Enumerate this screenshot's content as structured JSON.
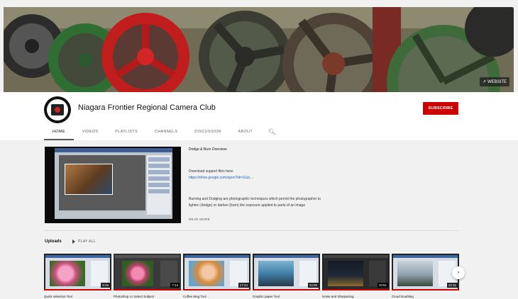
{
  "banner": {
    "links_label": "WEBSITE"
  },
  "channel": {
    "name": "Niagara Frontier Regional Camera Club",
    "subscribe_label": "SUBSCRIBE"
  },
  "tabs": [
    {
      "label": "HOME",
      "active": true
    },
    {
      "label": "VIDEOS"
    },
    {
      "label": "PLAYLISTS"
    },
    {
      "label": "CHANNELS"
    },
    {
      "label": "DISCUSSION"
    },
    {
      "label": "ABOUT"
    }
  ],
  "featured": {
    "title": "Dodge & Burn Overview",
    "desc_line1": "Download support files here:",
    "link": "https://drive.google.com/open?id=1GzL...",
    "desc_line2": "Burning and Dodging are photographic techniques which permit the photographer to lighten (dodge) or darken (burn) the exposure applied to parts of an image",
    "read_more": "READ MORE"
  },
  "uploads": {
    "title": "Uploads",
    "play_all": "PLAY ALL",
    "videos": [
      {
        "title": "Quick selection Tool",
        "duration": "8:46",
        "theme": "flower-pink"
      },
      {
        "title": "Photoshop cc Select Subject",
        "duration": "7:14",
        "theme": "flower-green"
      },
      {
        "title": "Coffee Mug Tool",
        "duration": "17:24",
        "theme": "portrait"
      },
      {
        "title": "Graphic paper Tool",
        "duration": "13:05",
        "theme": "ferris"
      },
      {
        "title": "Noise and Sharpening",
        "duration": "10:51",
        "theme": "night"
      },
      {
        "title": "Cloud Doubling",
        "duration": "10:32",
        "theme": "tree"
      }
    ]
  },
  "icons": {
    "search": "search-icon",
    "next": "chevron-right-icon",
    "play_all": "play-icon"
  },
  "colors": {
    "accent": "#cc0000",
    "link": "#1565c0"
  }
}
